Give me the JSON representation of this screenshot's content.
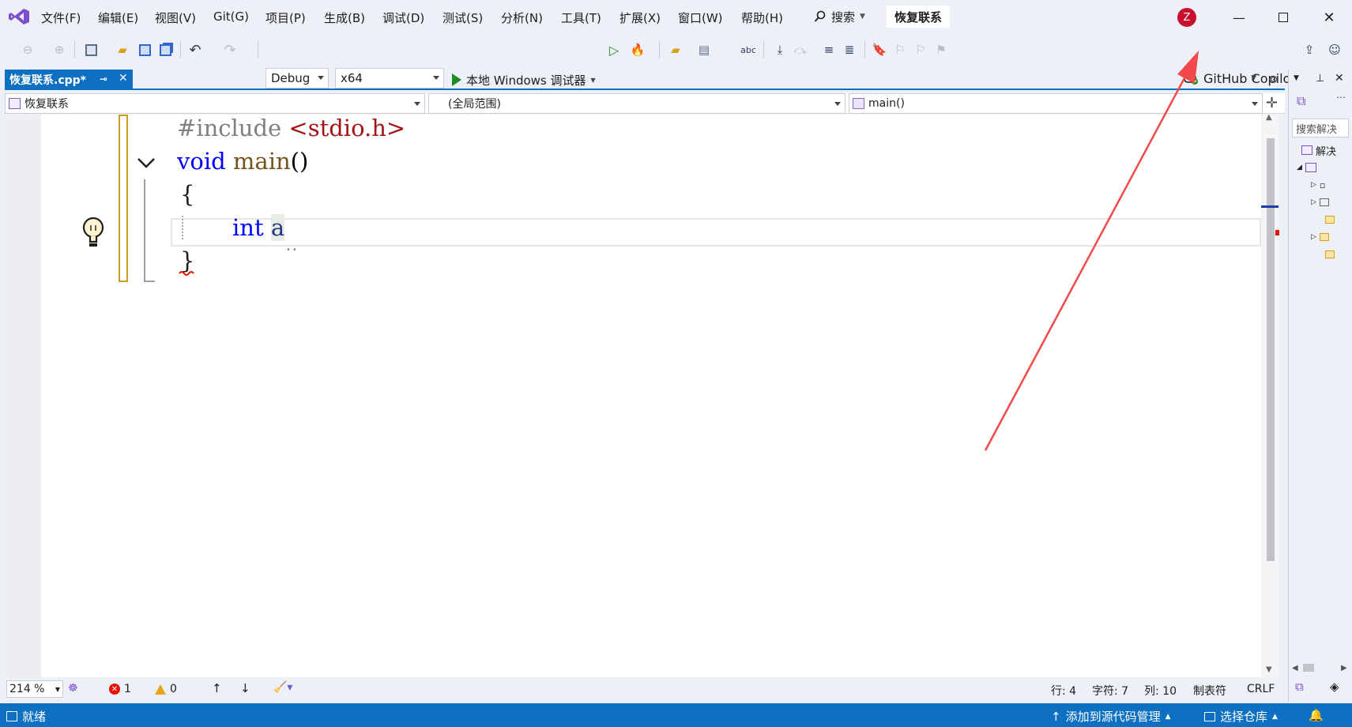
{
  "menu": {
    "items": [
      "文件(F)",
      "编辑(E)",
      "视图(V)",
      "Git(G)",
      "项目(P)",
      "生成(B)",
      "调试(D)",
      "测试(S)",
      "分析(N)",
      "工具(T)",
      "扩展(X)",
      "窗口(W)",
      "帮助(H)"
    ],
    "search_label": "搜索",
    "solution_title": "恢复联系",
    "avatar_letter": "Z"
  },
  "toolbar": {
    "config": "Debug",
    "platform": "x64",
    "run_label": "本地 Windows 调试器",
    "copilot_label": "GitHub Copilot"
  },
  "tab": {
    "title": "恢复联系.cpp*"
  },
  "navbar": {
    "project": "恢复联系",
    "scope": "(全局范围)",
    "member": "main()"
  },
  "code": {
    "line1_directive": "#include",
    "line1_header": "<stdio.h>",
    "line2_type": "void",
    "line2_name": "main",
    "line2_parens": "()",
    "line3": "{",
    "line4_type": "int",
    "line4_ident": "a",
    "line5": "}"
  },
  "right_panel": {
    "search_placeholder": "搜索解决",
    "solution_row": "解决"
  },
  "editor_status": {
    "zoom": "214 %",
    "errors": "1",
    "warnings": "0",
    "line": "行: 4",
    "char": "字符: 7",
    "col": "列: 10",
    "indent": "制表符",
    "eol": "CRLF"
  },
  "statusbar": {
    "ready": "就绪",
    "add_source": "添加到源代码管理",
    "select_repo": "选择仓库"
  },
  "colors": {
    "accent": "#0e70c0",
    "annotation": "#f24a4a",
    "keyword": "#0000ff",
    "string": "#a31515"
  }
}
